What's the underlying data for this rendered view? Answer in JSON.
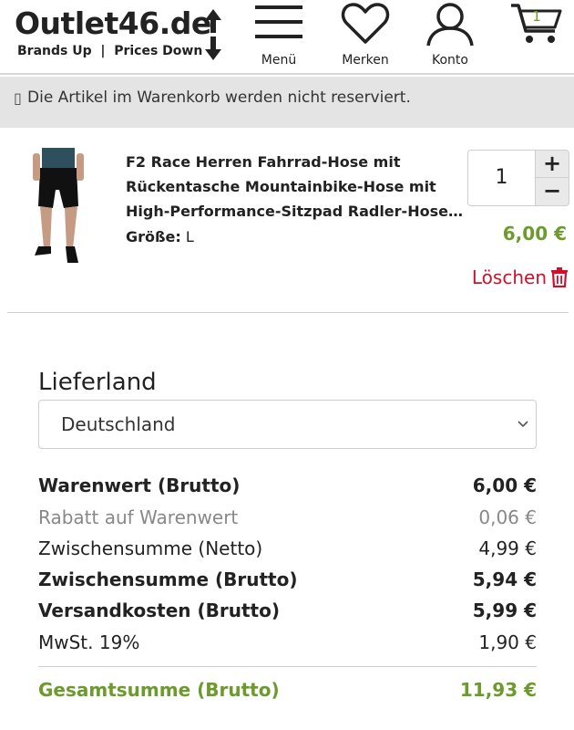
{
  "header": {
    "logo_text": "Outlet46.de",
    "logo_tagline": "Brands Up  |  Prices Down",
    "nav": [
      {
        "label": "Menü",
        "icon": "hamburger-icon"
      },
      {
        "label": "Merken",
        "icon": "heart-icon"
      },
      {
        "label": "Konto",
        "icon": "user-icon"
      }
    ],
    "cart_count": "1"
  },
  "notice": {
    "icon": "info-icon",
    "text": "Die Artikel im Warenkorb werden nicht reserviert."
  },
  "product": {
    "title_lines": [
      "F2 Race Herren Fahrrad-Hose mit",
      "Rückentasche Mountainbike-Hose mit",
      "High-Performance-Sitzpad Radler-Hose Fahrradhose"
    ],
    "size_label": "Größe:",
    "size_value": "L",
    "quantity": "1",
    "plus": "+",
    "minus": "−",
    "price": "6,00 €",
    "delete_label": "Löschen"
  },
  "shipping": {
    "label": "Lieferland",
    "selected": "Deutschland"
  },
  "summary": [
    {
      "label": "Warenwert (Brutto)",
      "value": "6,00 €",
      "style": "bold"
    },
    {
      "label": "Rabatt auf Warenwert",
      "value": "0,06 €",
      "style": "muted"
    },
    {
      "label": "Zwischensumme (Netto)",
      "value": "4,99 €",
      "style": "normal"
    },
    {
      "label": "Zwischensumme (Brutto)",
      "value": "5,94 €",
      "style": "bold"
    },
    {
      "label": "Versandkosten (Brutto)",
      "value": "5,99 €",
      "style": "bold"
    },
    {
      "label": "MwSt. 19%",
      "value": "1,90 €",
      "style": "normal"
    }
  ],
  "total": {
    "label": "Gesamtsumme (Brutto)",
    "value": "11,93 €"
  },
  "colors": {
    "accent_green": "#6c9a2c",
    "delete_red": "#d0112b",
    "notice_bg": "#e4e4e4"
  }
}
